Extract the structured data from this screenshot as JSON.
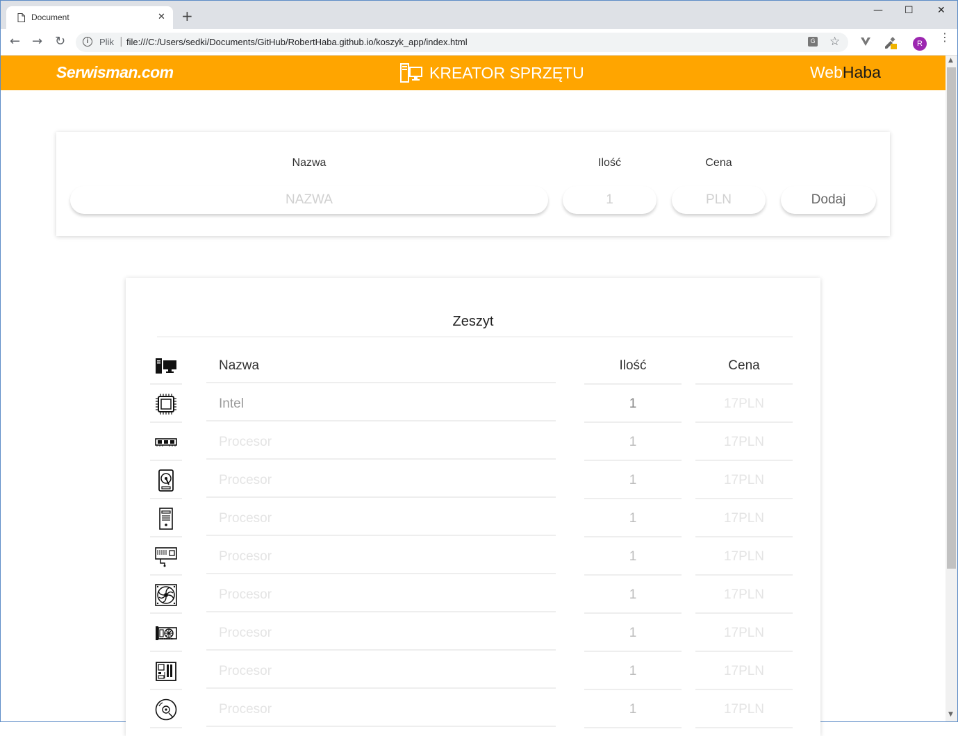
{
  "browser": {
    "tab_title": "Document",
    "new_tab": "+",
    "window_controls": {
      "minimize": "—",
      "maximize": "☐",
      "close": "✕"
    },
    "nav": {
      "back": "←",
      "forward": "→",
      "reload": "↻"
    },
    "address": {
      "scheme_label": "Plik",
      "separator": "|",
      "url": "file:///C:/Users/sedki/Documents/GitHub/RobertHaba.github.io/koszyk_app/index.html"
    },
    "profile_initial": "R",
    "menu": "⋮"
  },
  "header": {
    "brand_left": "Serwisman.com",
    "title": "KREATOR SPRZĘTU",
    "brand_right_a": "Web",
    "brand_right_b": "Haba",
    "accent": "#ffa500"
  },
  "form": {
    "name_label": "Nazwa",
    "qty_label": "Ilość",
    "price_label": "Cena",
    "name_placeholder": "NAZWA",
    "qty_placeholder": "1",
    "price_placeholder": "PLN",
    "add_button": "Dodaj"
  },
  "notebook": {
    "title": "Zeszyt",
    "columns": {
      "name": "Nazwa",
      "qty": "Ilość",
      "price": "Cena"
    },
    "rows": [
      {
        "icon": "cpu-icon",
        "name": "Intel",
        "qty": "1",
        "price": "17PLN"
      },
      {
        "icon": "ram-icon",
        "name": "Procesor",
        "qty": "1",
        "price": "17PLN"
      },
      {
        "icon": "hdd-icon",
        "name": "Procesor",
        "qty": "1",
        "price": "17PLN"
      },
      {
        "icon": "pc-case-icon",
        "name": "Procesor",
        "qty": "1",
        "price": "17PLN"
      },
      {
        "icon": "network-card-icon",
        "name": "Procesor",
        "qty": "1",
        "price": "17PLN"
      },
      {
        "icon": "fan-icon",
        "name": "Procesor",
        "qty": "1",
        "price": "17PLN"
      },
      {
        "icon": "graphics-card-icon",
        "name": "Procesor",
        "qty": "1",
        "price": "17PLN"
      },
      {
        "icon": "motherboard-icon",
        "name": "Procesor",
        "qty": "1",
        "price": "17PLN"
      },
      {
        "icon": "optical-disc-icon",
        "name": "Procesor",
        "qty": "1",
        "price": "17PLN"
      }
    ]
  }
}
